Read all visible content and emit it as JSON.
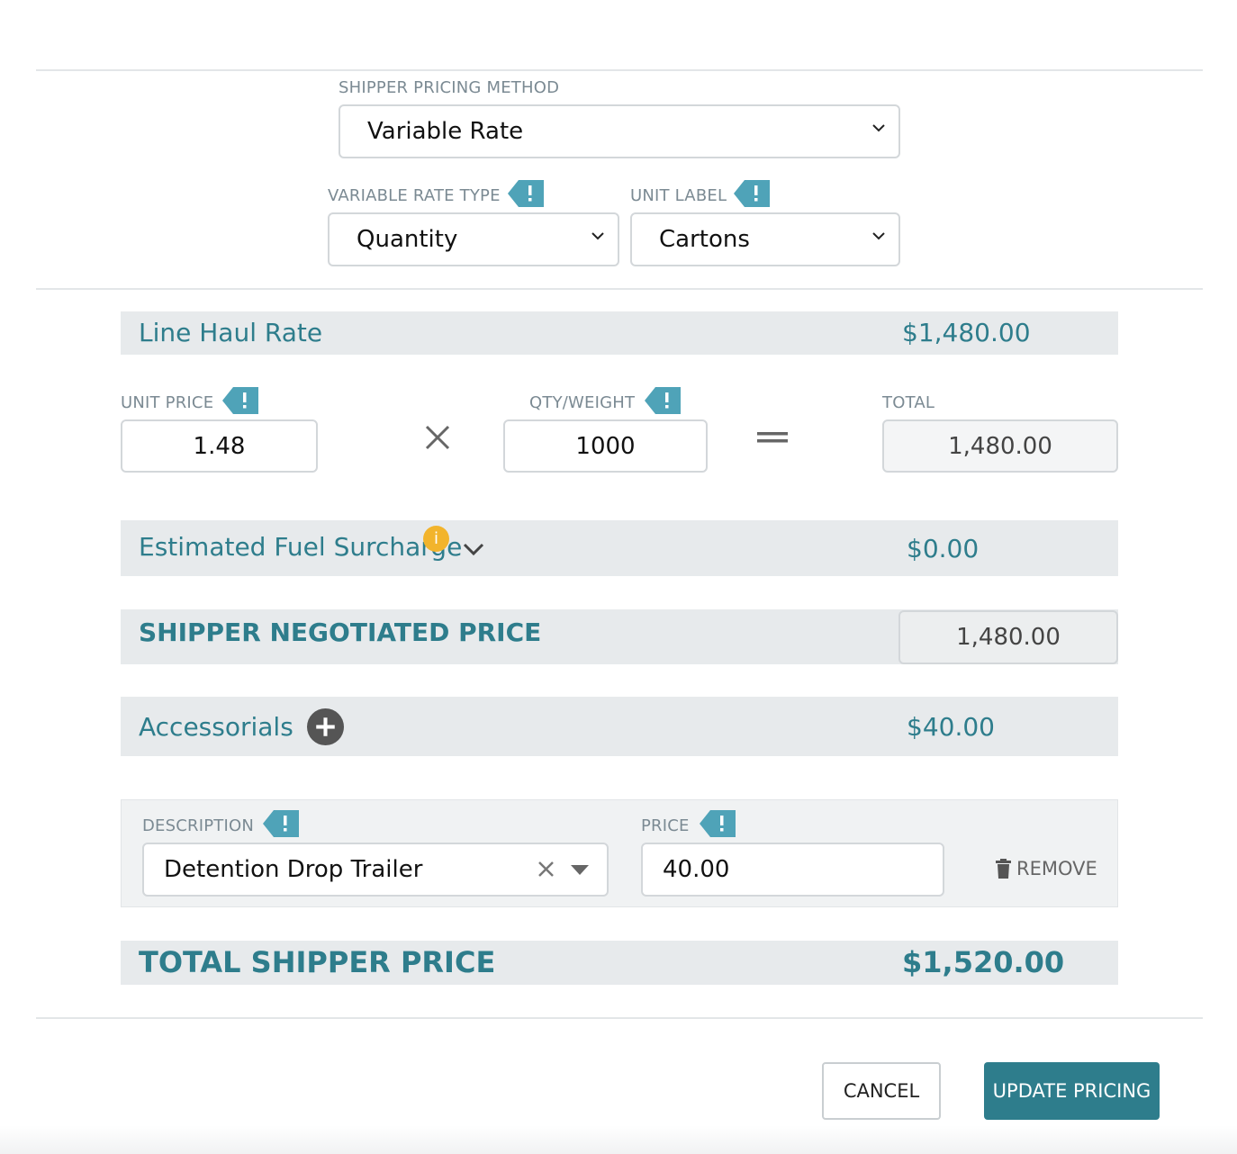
{
  "pricing_method": {
    "label": "SHIPPER PRICING METHOD",
    "value": "Variable Rate"
  },
  "rate_type": {
    "label": "VARIABLE RATE TYPE",
    "value": "Quantity"
  },
  "unit_label": {
    "label": "UNIT LABEL",
    "value": "Cartons"
  },
  "line_haul": {
    "title": "Line Haul Rate",
    "amount": "$1,480.00"
  },
  "calc": {
    "unit_price_label": "UNIT PRICE",
    "unit_price": "1.48",
    "qty_label": "QTY/WEIGHT",
    "qty": "1000",
    "total_label": "TOTAL",
    "total": "1,480.00"
  },
  "fuel": {
    "title": "Estimated Fuel Surcharge",
    "amount": "$0.00",
    "info_glyph": "i"
  },
  "negotiated": {
    "title": "SHIPPER NEGOTIATED PRICE",
    "value": "1,480.00"
  },
  "accessorials": {
    "title": "Accessorials",
    "amount": "$40.00"
  },
  "accessorial_row": {
    "description_label": "DESCRIPTION",
    "description": "Detention Drop Trailer",
    "price_label": "PRICE",
    "price": "40.00",
    "remove_label": "REMOVE"
  },
  "total": {
    "title": "TOTAL SHIPPER PRICE",
    "amount": "$1,520.00"
  },
  "footer": {
    "cancel_label": "CANCEL",
    "update_label": "UPDATE PRICING"
  },
  "colors": {
    "accent": "#2e7d8c",
    "flag": "#4fa3b8",
    "info": "#f2b42c",
    "band": "#e7eaec"
  },
  "icons": [
    "chevron-down-icon",
    "alert-flag-icon",
    "multiply-icon",
    "equals-icon",
    "info-icon",
    "plus-circle-icon",
    "clear-icon",
    "caret-down-icon",
    "trash-icon"
  ]
}
